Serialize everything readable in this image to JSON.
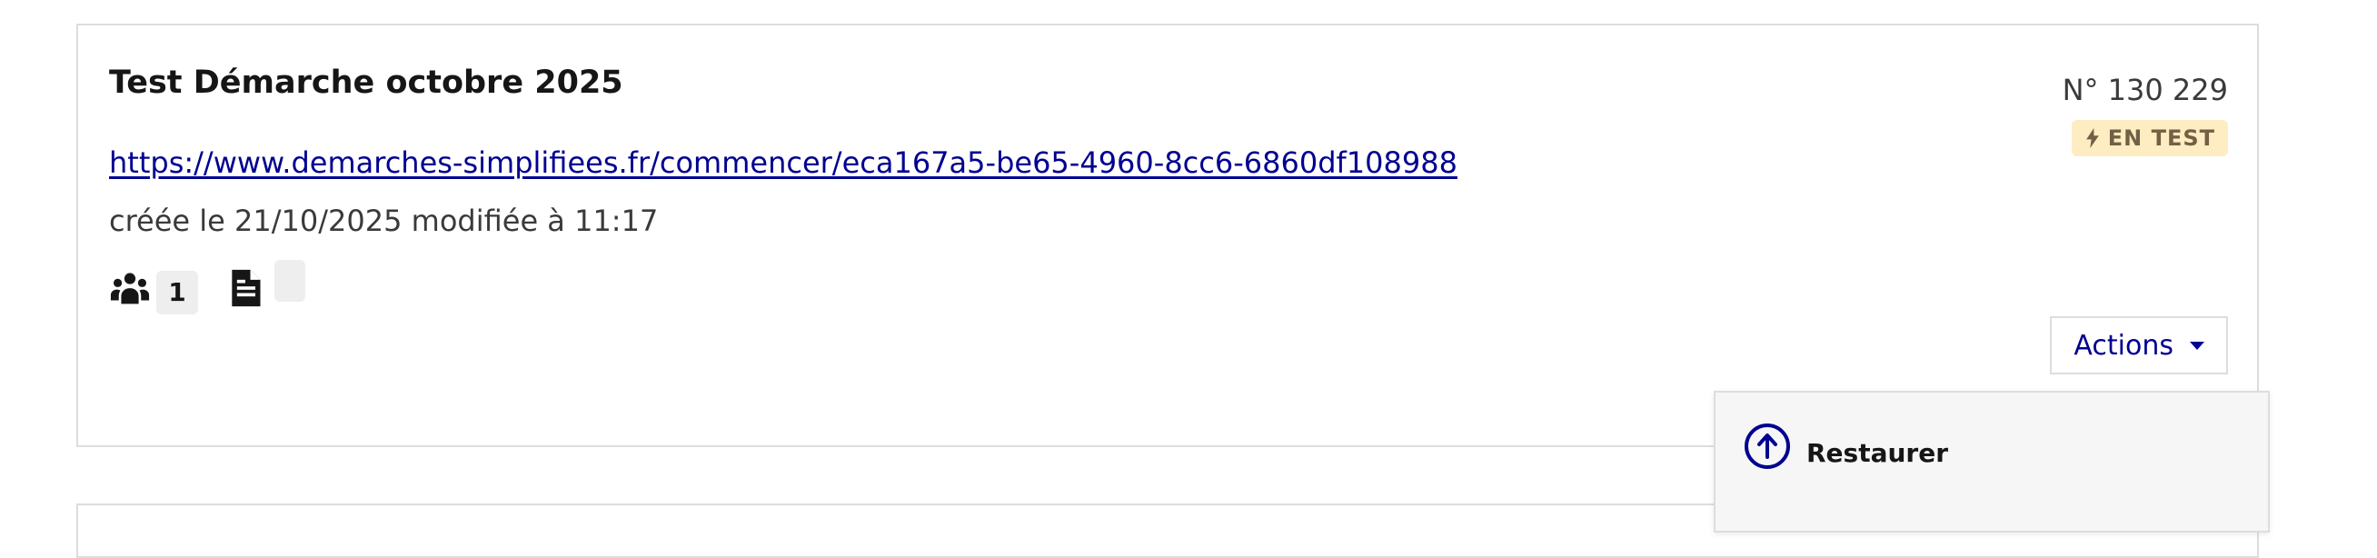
{
  "card": {
    "title": "Test Démarche octobre 2025",
    "link": "https://www.demarches-simplifiees.fr/commencer/eca167a5-be65-4960-8cc6-6860df108988",
    "dates": "créée le 21/10/2025 modifiée à 11:17",
    "number": "N° 130 229",
    "status_badge": "EN TEST",
    "status_icon": "lightning-icon",
    "stats": {
      "users_icon": "users-icon",
      "users_count": "1",
      "doc_icon": "document-icon",
      "doc_count": ""
    },
    "actions_label": "Actions"
  },
  "menu": {
    "items": [
      {
        "label": "Restaurer",
        "icon": "arrow-up-circle-icon"
      }
    ]
  },
  "colors": {
    "accent": "#000091",
    "badge_bg": "#feecc2",
    "badge_text": "#716043",
    "border": "#dddddd"
  }
}
